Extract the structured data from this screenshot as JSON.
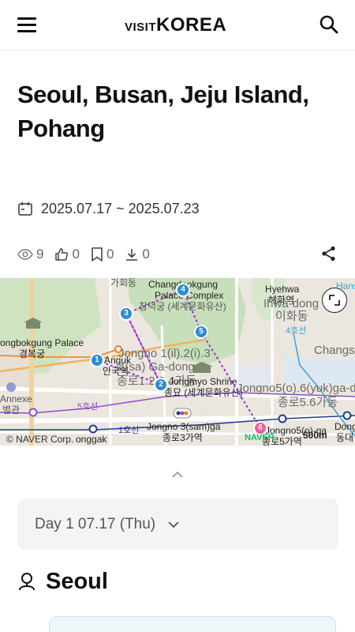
{
  "header": {
    "logo_visit": "VISIT",
    "logo_korea": "KOREA",
    "menu_icon": "hamburger-menu-icon",
    "search_icon": "search-icon"
  },
  "trip": {
    "title": "Seoul, Busan, Jeju Island, Pohang",
    "dates": "2025.07.17 ~ 2025.07.23"
  },
  "stats": {
    "views": "9",
    "likes": "0",
    "bookmarks": "0",
    "downloads": "0"
  },
  "map": {
    "labels": {
      "gahoe": "가회동",
      "changdeokgung": "Changdeokgung",
      "palace_complex": "Palace Complex",
      "changdeokgung_ko": "창덕궁 (세계문화유산)",
      "hyehwa": "Hyehwa",
      "hyehwa_ko": "혜화역",
      "ihwa_dong": "Ihwa-dong",
      "ihwa_dong_ko": "이화동",
      "gyeongbokgung": "ongbokgung Palace",
      "gyeongbokgung_ko": "경복궁",
      "anguk": "Anguk",
      "anguk_ko": "안국역",
      "jongno_ga": "Jongno 1(il).2(i).3",
      "jongno_ga2": ".4(sa) Ga-dong",
      "jongno_ko": "종로1.2.3.4가동",
      "jongmyo": "Jongmyo Shrine",
      "jongmyo_ko": "종묘 (세계문화유산)",
      "jongno56": "Jongno5(o).6(yuk)ga-d",
      "jongno56_ko": "종로5.6가동",
      "changsin": "Changs",
      "annexe": "Annexe",
      "annexe_ko": "별관",
      "line5": "5호선",
      "line1": "1호선",
      "line4": "4호선",
      "jongno3": "Jongno 3(sam)ga",
      "jongno3_ko": "종로3가역",
      "jongno5": "Jongno5(o)-ga",
      "jongno5_ko": "종로5가역",
      "dongdaemun": "Dongda",
      "dongdaemun_ko": "동대",
      "jonggak": "onggak",
      "hans": "Hans"
    },
    "markers": [
      "1",
      "2",
      "3",
      "4",
      "5",
      "6"
    ],
    "copyright": "© NAVER Corp.",
    "naver": "NAVER",
    "scale": "500m"
  },
  "itinerary": {
    "day_label": "Day 1 07.17 (Thu)",
    "city": "Seoul"
  }
}
